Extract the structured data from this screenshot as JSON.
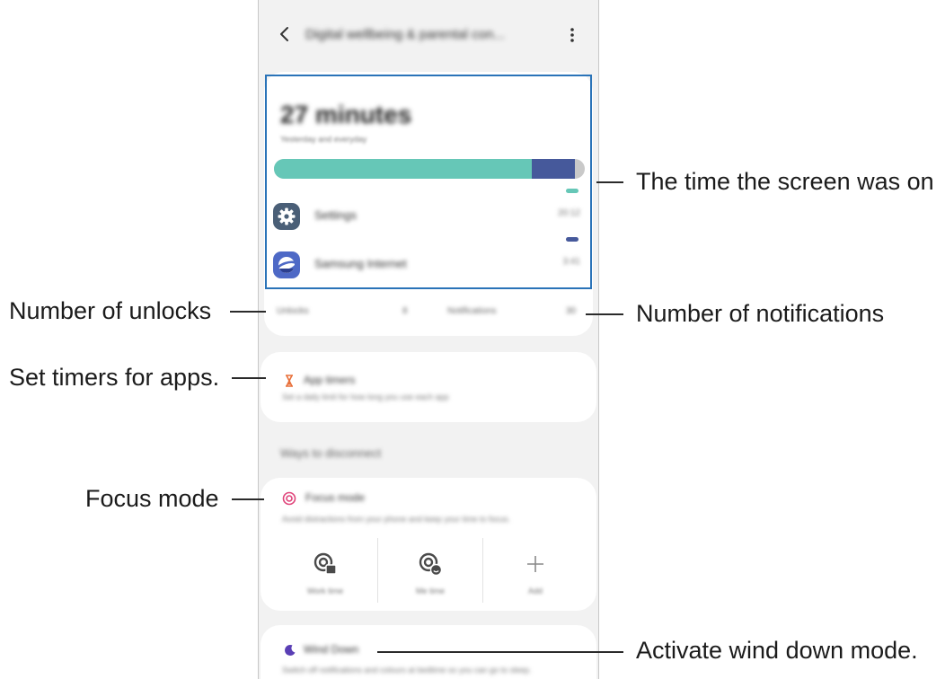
{
  "header": {
    "title": "Digital wellbeing & parental con...",
    "back_icon": "chevron-left-icon",
    "more_icon": "more-vertical-icon"
  },
  "dashboard": {
    "total_time": "27 minutes",
    "subtitle": "Yesterday and everyday",
    "usage_bar": [
      {
        "app": "Settings",
        "fraction": 0.83,
        "color": "#66c7b7"
      },
      {
        "app": "Samsung Internet",
        "fraction": 0.14,
        "color": "#46599b"
      }
    ],
    "bar_remainder_color": "#c9c9c9",
    "apps": [
      {
        "name": "Settings",
        "time": "20:12",
        "icon": "gear-icon",
        "icon_color": "#4a5f77",
        "dash_color": "#66c7b7"
      },
      {
        "name": "Samsung Internet",
        "time": "3:41",
        "icon": "samsung-internet-icon",
        "icon_color": "#4e69c6",
        "dash_color": "#46599b"
      }
    ],
    "unlocks_label": "Unlocks",
    "unlocks_value": "8",
    "notifications_label": "Notifications",
    "notifications_value": "30"
  },
  "app_timers": {
    "title": "App timers",
    "description": "Set a daily limit for how long you use each app",
    "icon": "hourglass-icon",
    "icon_color": "#e8703a"
  },
  "disconnect": {
    "section_title": "Ways to disconnect",
    "focus": {
      "title": "Focus mode",
      "description": "Avoid distractions from your phone and keep your time to focus.",
      "icon": "focus-target-icon",
      "icon_color": "#e0457b"
    },
    "modes": [
      {
        "label": "Work time",
        "icon": "work-focus-icon"
      },
      {
        "label": "Me time",
        "icon": "me-focus-icon"
      },
      {
        "label": "Add",
        "icon": "plus-icon"
      }
    ],
    "wind_down": {
      "title": "Wind Down",
      "description": "Switch off notifications and colours at bedtime so you can go to sleep.",
      "icon": "moon-icon",
      "icon_color": "#5a3fb5"
    }
  },
  "callouts": {
    "screen_on": "The time the screen was on",
    "unlocks": "Number of unlocks",
    "notifications": "Number of notifications",
    "timers": "Set timers for apps.",
    "focus": "Focus mode",
    "wind_down": "Activate wind down mode."
  }
}
